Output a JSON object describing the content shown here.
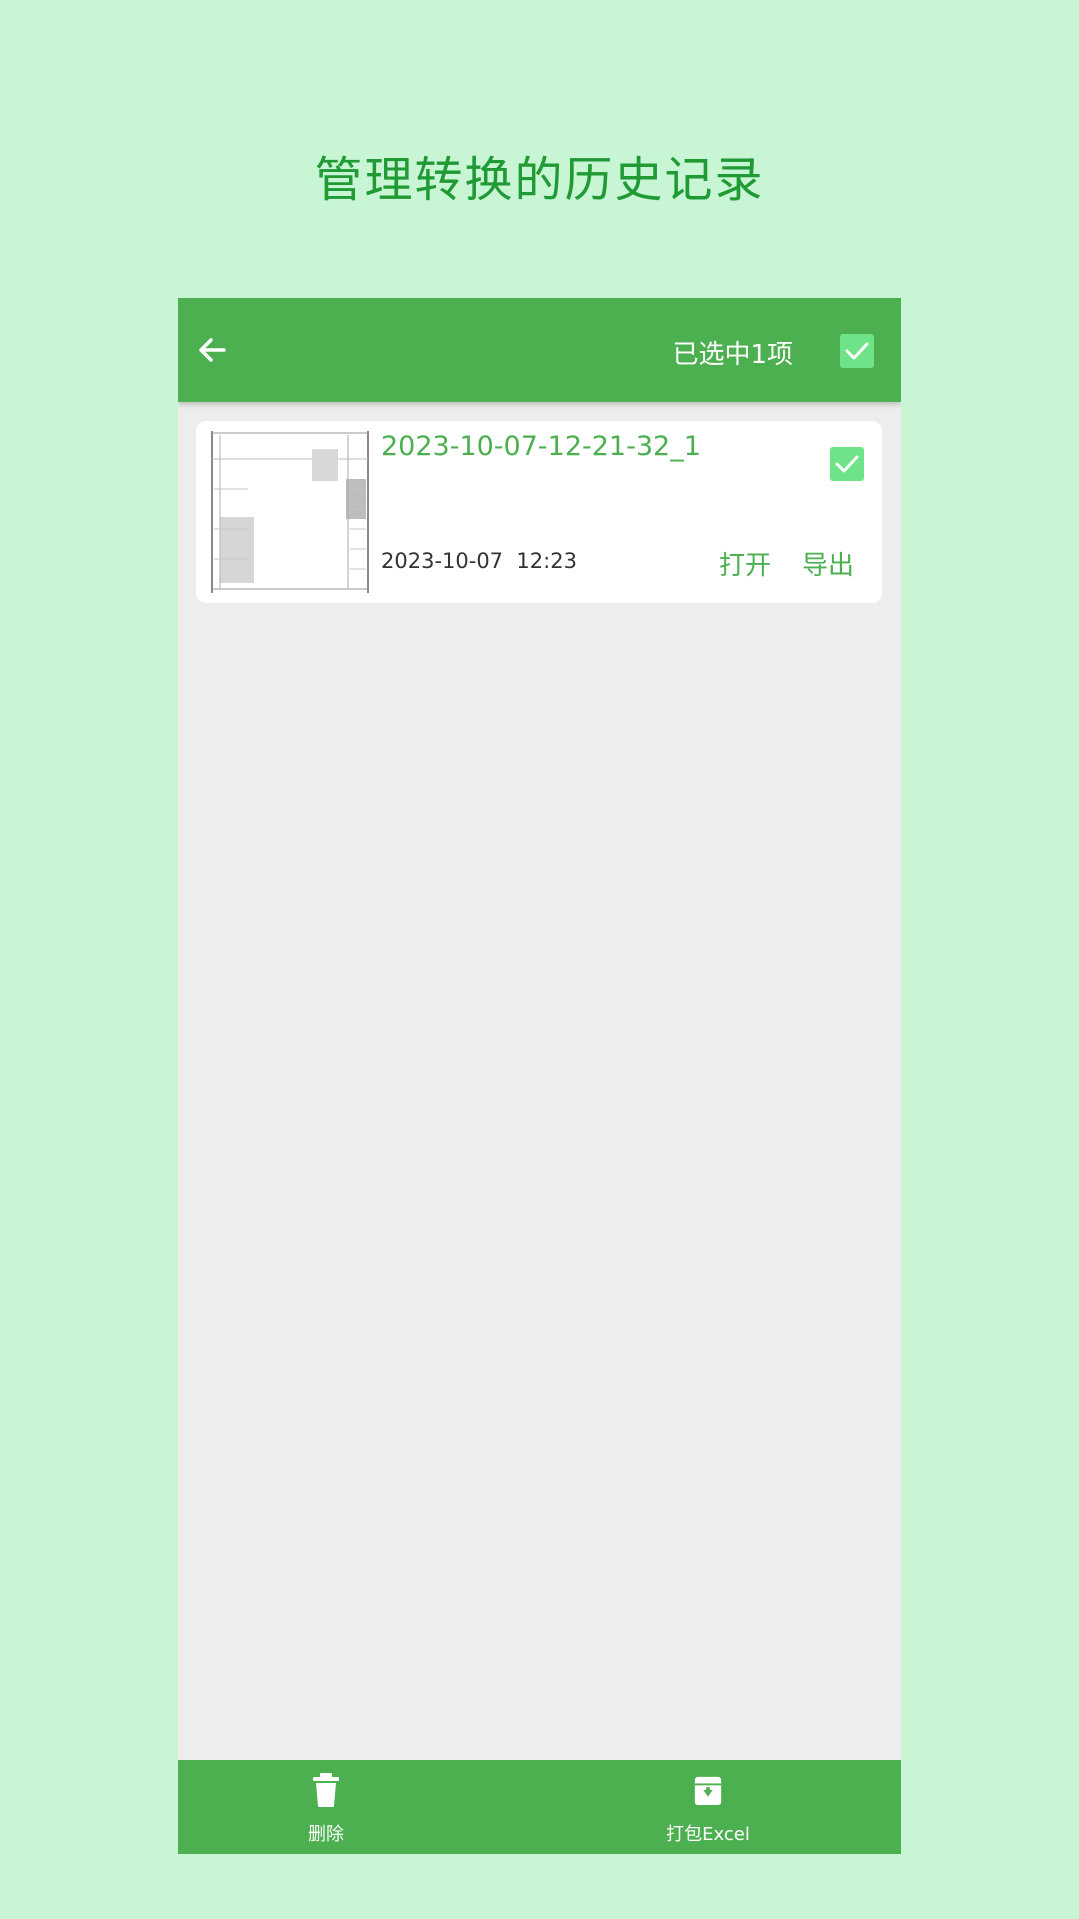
{
  "headline": "管理转换的历史记录",
  "appbar": {
    "selected_text": "已选中1项",
    "select_all_checked": true
  },
  "records": [
    {
      "title": "2023-10-07-12-21-32_1",
      "date": "2023-10-07",
      "time": "12:23",
      "checked": true,
      "open_label": "打开",
      "export_label": "导出"
    }
  ],
  "bottom_bar": {
    "delete_label": "删除",
    "pack_label": "打包Excel"
  },
  "colors": {
    "background": "#c8f5d4",
    "primary": "#4caf50",
    "checkbox": "#6fe388",
    "headline": "#1f9a34"
  }
}
